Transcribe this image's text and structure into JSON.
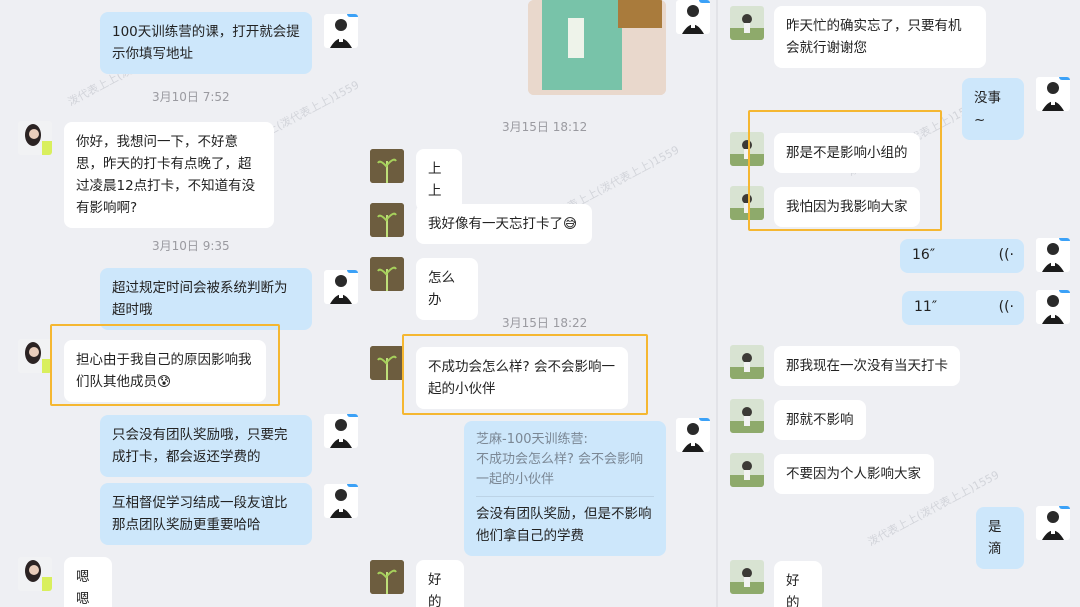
{
  "colors": {
    "page_bg": "#eeeff3",
    "incoming_bubble": "#ffffff",
    "outgoing_bubble": "#cde7fb",
    "highlight_box": "#f5b731"
  },
  "watermark": "泼代表上上(泼代表上上)1559",
  "col1": {
    "msg1": "100天训练营的课，打开就会提示你填写地址",
    "ts1": "3月10日 7:52",
    "msg2": "你好，我想问一下，不好意思，昨天的打卡有点晚了，超过凌晨12点打卡，不知道有没有影响啊?",
    "ts2": "3月10日 9:35",
    "msg3": "超过规定时间会被系统判断为超时哦",
    "msg4": "担心由于我自己的原因影响我们队其他成员😰",
    "msg5": "只会没有团队奖励哦，只要完成打卡，都会返还学费的",
    "msg6": "互相督促学习结成一段友谊比那点团队奖励更重要哈哈",
    "msg7": "嗯嗯"
  },
  "col2": {
    "ts1": "3月15日 18:12",
    "msg1": "上上",
    "msg2": "我好像有一天忘打卡了😅",
    "msg3": "怎么办",
    "ts2": "3月15日 18:22",
    "msg4": "不成功会怎么样? 会不会影响一起的小伙伴",
    "quote_sender": "芝麻-100天训练营:",
    "quote_text": "不成功会怎么样? 会不会影响一起的小伙伴",
    "msg5": "会没有团队奖励，但是不影响他们拿自己的学费",
    "msg6": "好的"
  },
  "col3": {
    "msg1": "昨天忙的确实忘了，只要有机会就行谢谢您",
    "msg2": "没事 ~",
    "msg3": "那是不是影响小组的",
    "msg4": "我怕因为我影响大家",
    "voice1": "16″",
    "voice2": "11″",
    "msg5": "那我现在一次没有当天打卡",
    "msg6": "那就不影响",
    "msg7": "不要因为个人影响大家",
    "msg8": "是滴",
    "msg9": "好的"
  },
  "icons": {
    "voice": "voice-wave-icon"
  }
}
